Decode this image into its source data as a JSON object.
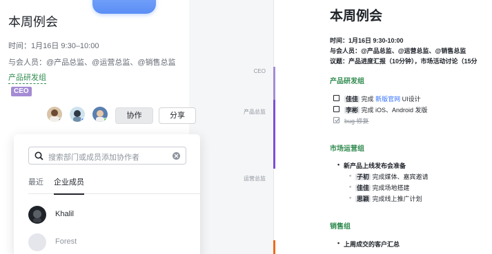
{
  "left_panel": {
    "title": "本周例会",
    "time": "时间：1月16日 9:30–10:00",
    "attendees": "与会人员：@产品总监、@运营总监、@销售总监",
    "group_link": "产品研发组",
    "ceo_tag": "CEO",
    "buttons": {
      "collaborate": "协作",
      "share": "分享"
    }
  },
  "popup": {
    "search_placeholder": "搜索部门或成员添加协作者",
    "tabs": {
      "recent": "最近",
      "members": "企业成员"
    },
    "members": [
      {
        "name": "Khalil"
      },
      {
        "name": "Forest"
      }
    ]
  },
  "middle": {
    "labels": {
      "ceo": "CEO",
      "product": "产品总监",
      "ops": "运营总监"
    },
    "colors": {
      "ceo": "#a48bd4",
      "product": "#7b4fd6",
      "ops": "#f26a1b"
    }
  },
  "document": {
    "title": "本周例会",
    "time": "时间：1月16日 9:30-10:00",
    "attendees": "与会人员：@产品总监、@运营总监、@销售总监",
    "agenda": "议题：产品进度汇报（10分钟），市场活动讨论（15分",
    "section_product": "产品研发组",
    "todo1": {
      "mention": "佳佳",
      "pre": "完成",
      "link": "新版官网",
      "post": "UI设计"
    },
    "todo2": {
      "mention": "李彬",
      "text": "完成 iOS、Android 发版"
    },
    "todo3": {
      "text": "bug 修复"
    },
    "section_market": "市场运营组",
    "market_item": "新产品上线发布会准备",
    "market_sub": [
      {
        "mention": "子初",
        "text": "完成媒体、嘉宾邀请"
      },
      {
        "mention": "佳佳",
        "text": "完成场地搭建"
      },
      {
        "mention": "思颖",
        "text": "完成线上推广计划"
      }
    ],
    "section_sales": "销售组",
    "sales_item": "上周成交的客户汇总"
  },
  "colors": {
    "accent_green": "#2f8a4e",
    "link_blue": "#3370ff"
  }
}
